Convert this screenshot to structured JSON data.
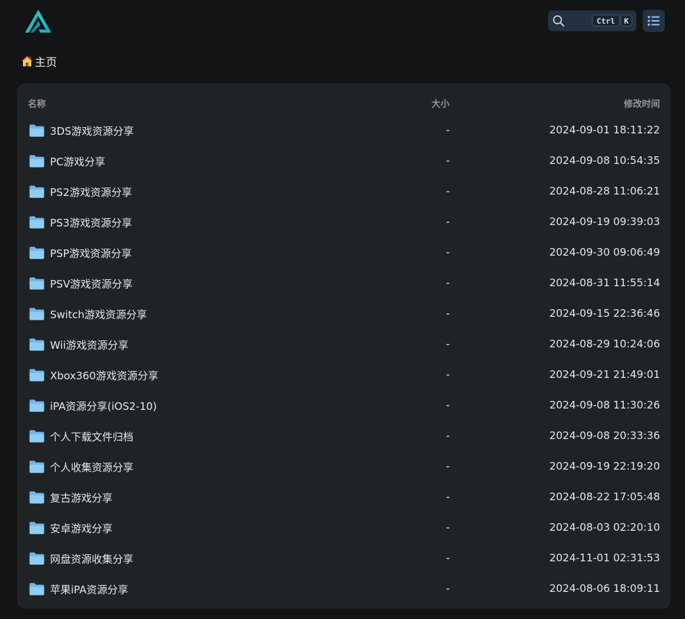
{
  "header": {
    "logo_icon": "alist-logo-icon",
    "search": {
      "icon": "search-icon",
      "shortcut_keys": [
        "Ctrl",
        "K"
      ]
    },
    "layout_toggle_icon": "list-icon"
  },
  "breadcrumb": {
    "icon": "house-icon",
    "home_label": "主页"
  },
  "table": {
    "headers": {
      "name": "名称",
      "size": "大小",
      "modified": "修改时间"
    },
    "rows": [
      {
        "name": "3DS游戏资源分享",
        "size": "-",
        "modified": "2024-09-01 18:11:22"
      },
      {
        "name": "PC游戏分享",
        "size": "-",
        "modified": "2024-09-08 10:54:35"
      },
      {
        "name": "PS2游戏资源分享",
        "size": "-",
        "modified": "2024-08-28 11:06:21"
      },
      {
        "name": "PS3游戏资源分享",
        "size": "-",
        "modified": "2024-09-19 09:39:03"
      },
      {
        "name": "PSP游戏资源分享",
        "size": "-",
        "modified": "2024-09-30 09:06:49"
      },
      {
        "name": "PSV游戏资源分享",
        "size": "-",
        "modified": "2024-08-31 11:55:14"
      },
      {
        "name": "Switch游戏资源分享",
        "size": "-",
        "modified": "2024-09-15 22:36:46"
      },
      {
        "name": "Wii游戏资源分享",
        "size": "-",
        "modified": "2024-08-29 10:24:06"
      },
      {
        "name": "Xbox360游戏资源分享",
        "size": "-",
        "modified": "2024-09-21 21:49:01"
      },
      {
        "name": "iPA资源分享(iOS2-10)",
        "size": "-",
        "modified": "2024-09-08 11:30:26"
      },
      {
        "name": "个人下载文件归档",
        "size": "-",
        "modified": "2024-09-08 20:33:36"
      },
      {
        "name": "个人收集资源分享",
        "size": "-",
        "modified": "2024-09-19 22:19:20"
      },
      {
        "name": "复古游戏分享",
        "size": "-",
        "modified": "2024-08-22 17:05:48"
      },
      {
        "name": "安卓游戏分享",
        "size": "-",
        "modified": "2024-08-03 02:20:10"
      },
      {
        "name": "网盘资源收集分享",
        "size": "-",
        "modified": "2024-11-01 02:31:53"
      },
      {
        "name": "苹果iPA资源分享",
        "size": "-",
        "modified": "2024-08-06 18:09:11"
      }
    ]
  },
  "colors": {
    "background": "#121416",
    "panel": "#1f2325",
    "folder": "#90cdf4",
    "accent": "#233240"
  }
}
